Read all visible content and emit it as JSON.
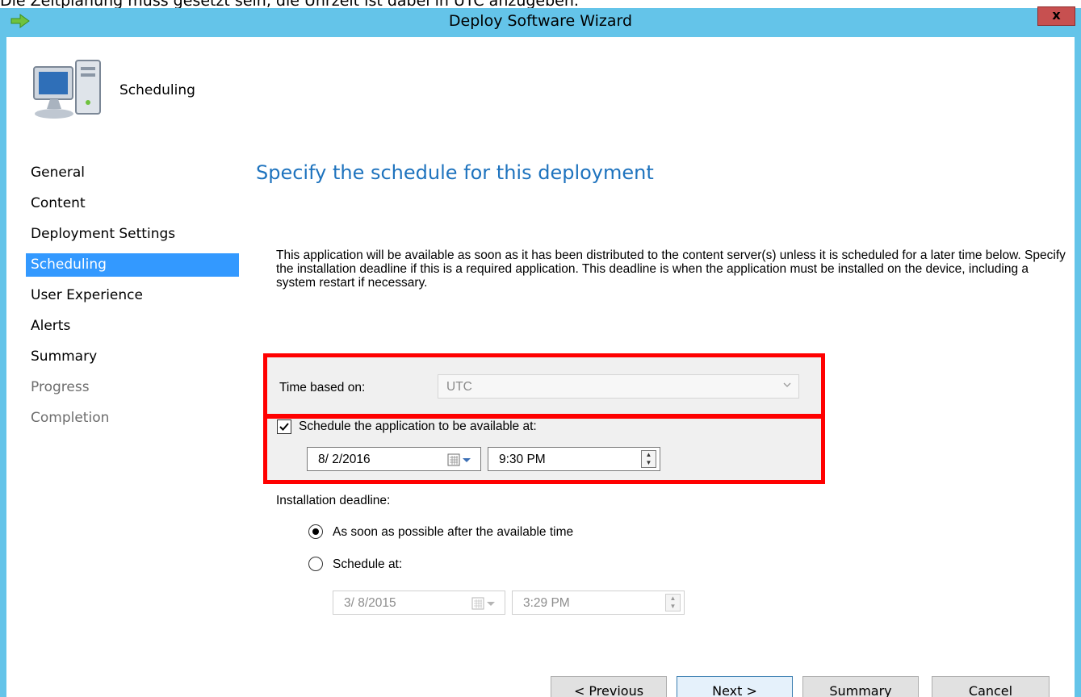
{
  "caption": "Die Zeitplanung muss gesetzt sein, die Uhrzeit ist dabei in UTC anzugeben.",
  "window": {
    "title": "Deploy Software Wizard",
    "close_label": "x"
  },
  "header": {
    "title": "Scheduling"
  },
  "nav": {
    "items": [
      {
        "label": "General",
        "state": "normal"
      },
      {
        "label": "Content",
        "state": "normal"
      },
      {
        "label": "Deployment Settings",
        "state": "normal"
      },
      {
        "label": "Scheduling",
        "state": "active"
      },
      {
        "label": "User Experience",
        "state": "normal"
      },
      {
        "label": "Alerts",
        "state": "normal"
      },
      {
        "label": "Summary",
        "state": "normal"
      },
      {
        "label": "Progress",
        "state": "disabled"
      },
      {
        "label": "Completion",
        "state": "disabled"
      }
    ]
  },
  "main": {
    "heading": "Specify the schedule for this deployment",
    "description": "This application will be available as soon as it has been distributed to the content server(s) unless it is scheduled for a later time below. Specify the installation deadline if this is a required application. This deadline is when the application must be installed on the device, including a system restart if necessary.",
    "time_based_label": "Time based on:",
    "time_based_value": "UTC",
    "schedule_available_label": "Schedule the application to be available at:",
    "schedule_available_checked": true,
    "available_date": "8/ 2/2016",
    "available_time": "9:30 PM",
    "deadline_label": "Installation deadline:",
    "deadline_asap_label": "As soon as possible after the available time",
    "deadline_schedule_label": "Schedule at:",
    "deadline_selected": "asap",
    "deadline_date": "3/ 8/2015",
    "deadline_time": "3:29 PM"
  },
  "buttons": {
    "previous": "< Previous",
    "next": "Next >",
    "summary": "Summary",
    "cancel": "Cancel"
  },
  "colors": {
    "title_bar": "#64c4e9",
    "nav_active": "#3399ff",
    "heading": "#1e73be",
    "highlight": "#ff0000"
  }
}
